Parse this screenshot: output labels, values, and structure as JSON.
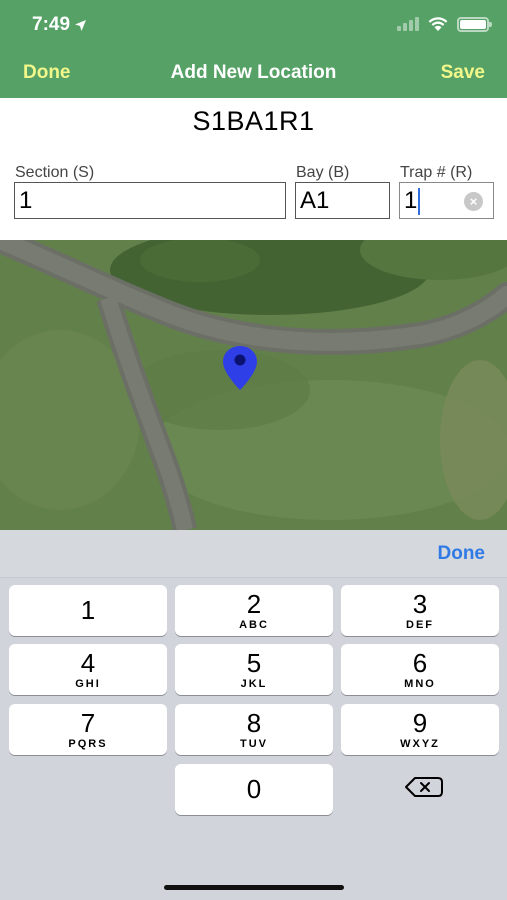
{
  "status_bar": {
    "time": "7:49",
    "location_icon": "location-arrow-icon",
    "signal_icon": "cellular-signal-icon",
    "wifi_icon": "wifi-icon",
    "battery_icon": "battery-icon",
    "battery_level": 1.0
  },
  "nav": {
    "left_label": "Done",
    "title": "Add New Location",
    "right_label": "Save",
    "accent_color": "#f2f78a",
    "bar_color": "#55a166"
  },
  "location_code": "S1BA1R1",
  "fields": {
    "section": {
      "label": "Section (S)",
      "value": "1"
    },
    "bay": {
      "label": "Bay (B)",
      "value": "A1"
    },
    "trap": {
      "label": "Trap # (R)",
      "value": "1",
      "clear_icon": "clear-circle-icon"
    }
  },
  "map": {
    "type": "satellite",
    "pin_icon": "map-pin-icon",
    "pin_color": "#2f3fe8"
  },
  "keyboard": {
    "done_label": "Done",
    "done_color": "#2f7ae5",
    "keys": [
      {
        "num": "1",
        "letters": ""
      },
      {
        "num": "2",
        "letters": "ABC"
      },
      {
        "num": "3",
        "letters": "DEF"
      },
      {
        "num": "4",
        "letters": "GHI"
      },
      {
        "num": "5",
        "letters": "JKL"
      },
      {
        "num": "6",
        "letters": "MNO"
      },
      {
        "num": "7",
        "letters": "PQRS"
      },
      {
        "num": "8",
        "letters": "TUV"
      },
      {
        "num": "9",
        "letters": "WXYZ"
      },
      {
        "num": "0",
        "letters": ""
      }
    ],
    "delete_icon": "backspace-icon"
  }
}
